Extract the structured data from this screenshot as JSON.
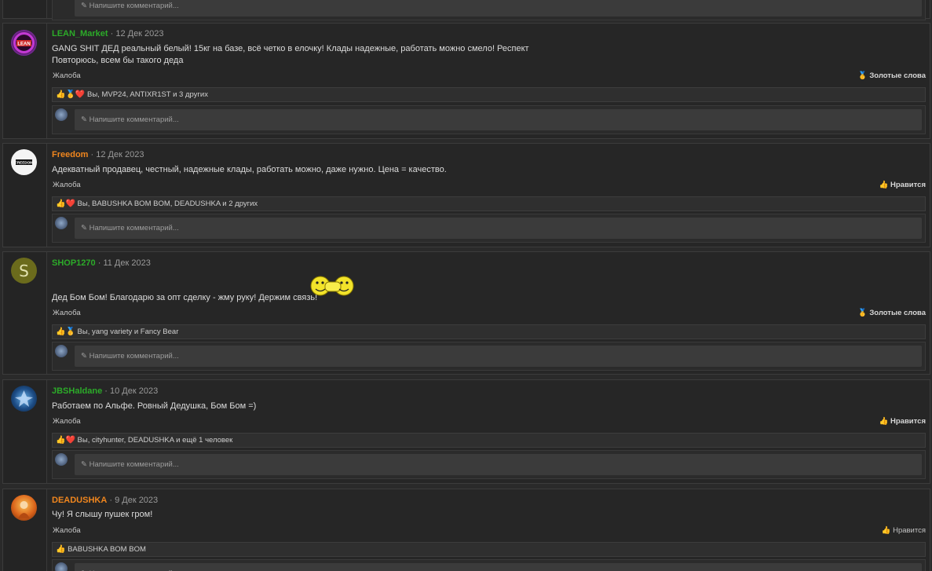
{
  "comment_placeholder": "Напишите комментарий...",
  "report_label": "Жалоба",
  "top_partial": {
    "placeholder": "Напишите комментарий..."
  },
  "posts": [
    {
      "username": "LEAN_Market",
      "date": "12 Дек 2023",
      "lines": [
        "GANG SHIT ДЕД реальный белый! 15кг на базе, всё четко в елочку! Клады надежные, работать можно смело! Респект",
        "Повторюсь, всем бы такого деда"
      ],
      "reaction_button": "Золотые слова",
      "reactions_emoji": "👍🥇❤️",
      "reactions_text": "Вы, MVP24, ANTIXR1ST и 3 других"
    },
    {
      "username": "Freedom",
      "date": "12 Дек 2023",
      "lines": [
        "Адекватный продавец, честный, надежные клады, работать можно, даже нужно. Цена = качество."
      ],
      "reaction_button": "Нравится",
      "reactions_emoji": "👍❤️",
      "reactions_text": "Вы, BABUSHKA BOM BOM, DEADUSHKA и 2 других",
      "avatar_text": "FREEDOM"
    },
    {
      "username": "SHOP1270",
      "date": "11 Дек 2023",
      "lines": [
        "Дед Бом Бом! Благодарю за опт сделку - жму руку! Держим связь!"
      ],
      "reaction_button": "Золотые слова",
      "reactions_emoji": "👍🥇",
      "reactions_text": "Вы, yang variety и Fancy Bear",
      "avatar_letter": "S"
    },
    {
      "username": "JBSHaldane",
      "date": "10 Дек 2023",
      "lines": [
        "Работаем по Альфе. Ровный Дедушка, Бом Бом =)"
      ],
      "reaction_button": "Нравится",
      "reactions_emoji": "👍❤️",
      "reactions_text": "Вы, cityhunter, DEADUSHKA и ещё 1 человек"
    },
    {
      "username": "DEADUSHKA",
      "date": "9 Дек 2023",
      "lines": [
        "Чу! Я слышу пушек гром!"
      ],
      "reaction_button": "Нравится",
      "reactions_emoji": "👍",
      "reactions_text": "BABUSHKA BOM BOM"
    }
  ],
  "colors": {
    "green_user": "#2cab29",
    "orange_user": "#f0861e",
    "background": "#2a2a2a"
  }
}
